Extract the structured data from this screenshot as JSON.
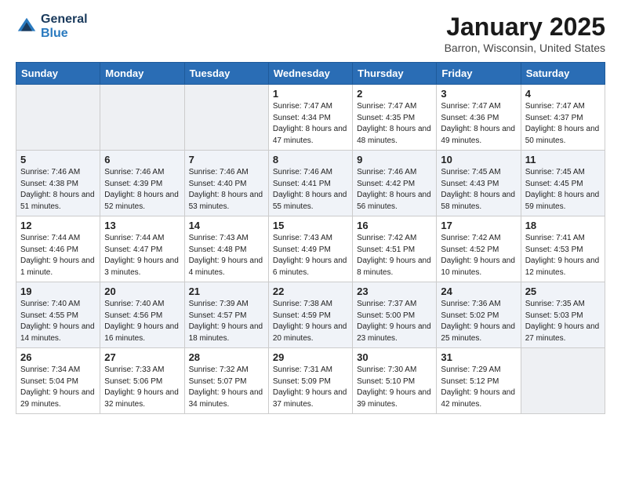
{
  "header": {
    "logo_line1": "General",
    "logo_line2": "Blue",
    "month": "January 2025",
    "location": "Barron, Wisconsin, United States"
  },
  "weekdays": [
    "Sunday",
    "Monday",
    "Tuesday",
    "Wednesday",
    "Thursday",
    "Friday",
    "Saturday"
  ],
  "weeks": [
    [
      {
        "day": "",
        "text": ""
      },
      {
        "day": "",
        "text": ""
      },
      {
        "day": "",
        "text": ""
      },
      {
        "day": "1",
        "text": "Sunrise: 7:47 AM\nSunset: 4:34 PM\nDaylight: 8 hours and 47 minutes."
      },
      {
        "day": "2",
        "text": "Sunrise: 7:47 AM\nSunset: 4:35 PM\nDaylight: 8 hours and 48 minutes."
      },
      {
        "day": "3",
        "text": "Sunrise: 7:47 AM\nSunset: 4:36 PM\nDaylight: 8 hours and 49 minutes."
      },
      {
        "day": "4",
        "text": "Sunrise: 7:47 AM\nSunset: 4:37 PM\nDaylight: 8 hours and 50 minutes."
      }
    ],
    [
      {
        "day": "5",
        "text": "Sunrise: 7:46 AM\nSunset: 4:38 PM\nDaylight: 8 hours and 51 minutes."
      },
      {
        "day": "6",
        "text": "Sunrise: 7:46 AM\nSunset: 4:39 PM\nDaylight: 8 hours and 52 minutes."
      },
      {
        "day": "7",
        "text": "Sunrise: 7:46 AM\nSunset: 4:40 PM\nDaylight: 8 hours and 53 minutes."
      },
      {
        "day": "8",
        "text": "Sunrise: 7:46 AM\nSunset: 4:41 PM\nDaylight: 8 hours and 55 minutes."
      },
      {
        "day": "9",
        "text": "Sunrise: 7:46 AM\nSunset: 4:42 PM\nDaylight: 8 hours and 56 minutes."
      },
      {
        "day": "10",
        "text": "Sunrise: 7:45 AM\nSunset: 4:43 PM\nDaylight: 8 hours and 58 minutes."
      },
      {
        "day": "11",
        "text": "Sunrise: 7:45 AM\nSunset: 4:45 PM\nDaylight: 8 hours and 59 minutes."
      }
    ],
    [
      {
        "day": "12",
        "text": "Sunrise: 7:44 AM\nSunset: 4:46 PM\nDaylight: 9 hours and 1 minute."
      },
      {
        "day": "13",
        "text": "Sunrise: 7:44 AM\nSunset: 4:47 PM\nDaylight: 9 hours and 3 minutes."
      },
      {
        "day": "14",
        "text": "Sunrise: 7:43 AM\nSunset: 4:48 PM\nDaylight: 9 hours and 4 minutes."
      },
      {
        "day": "15",
        "text": "Sunrise: 7:43 AM\nSunset: 4:49 PM\nDaylight: 9 hours and 6 minutes."
      },
      {
        "day": "16",
        "text": "Sunrise: 7:42 AM\nSunset: 4:51 PM\nDaylight: 9 hours and 8 minutes."
      },
      {
        "day": "17",
        "text": "Sunrise: 7:42 AM\nSunset: 4:52 PM\nDaylight: 9 hours and 10 minutes."
      },
      {
        "day": "18",
        "text": "Sunrise: 7:41 AM\nSunset: 4:53 PM\nDaylight: 9 hours and 12 minutes."
      }
    ],
    [
      {
        "day": "19",
        "text": "Sunrise: 7:40 AM\nSunset: 4:55 PM\nDaylight: 9 hours and 14 minutes."
      },
      {
        "day": "20",
        "text": "Sunrise: 7:40 AM\nSunset: 4:56 PM\nDaylight: 9 hours and 16 minutes."
      },
      {
        "day": "21",
        "text": "Sunrise: 7:39 AM\nSunset: 4:57 PM\nDaylight: 9 hours and 18 minutes."
      },
      {
        "day": "22",
        "text": "Sunrise: 7:38 AM\nSunset: 4:59 PM\nDaylight: 9 hours and 20 minutes."
      },
      {
        "day": "23",
        "text": "Sunrise: 7:37 AM\nSunset: 5:00 PM\nDaylight: 9 hours and 23 minutes."
      },
      {
        "day": "24",
        "text": "Sunrise: 7:36 AM\nSunset: 5:02 PM\nDaylight: 9 hours and 25 minutes."
      },
      {
        "day": "25",
        "text": "Sunrise: 7:35 AM\nSunset: 5:03 PM\nDaylight: 9 hours and 27 minutes."
      }
    ],
    [
      {
        "day": "26",
        "text": "Sunrise: 7:34 AM\nSunset: 5:04 PM\nDaylight: 9 hours and 29 minutes."
      },
      {
        "day": "27",
        "text": "Sunrise: 7:33 AM\nSunset: 5:06 PM\nDaylight: 9 hours and 32 minutes."
      },
      {
        "day": "28",
        "text": "Sunrise: 7:32 AM\nSunset: 5:07 PM\nDaylight: 9 hours and 34 minutes."
      },
      {
        "day": "29",
        "text": "Sunrise: 7:31 AM\nSunset: 5:09 PM\nDaylight: 9 hours and 37 minutes."
      },
      {
        "day": "30",
        "text": "Sunrise: 7:30 AM\nSunset: 5:10 PM\nDaylight: 9 hours and 39 minutes."
      },
      {
        "day": "31",
        "text": "Sunrise: 7:29 AM\nSunset: 5:12 PM\nDaylight: 9 hours and 42 minutes."
      },
      {
        "day": "",
        "text": ""
      }
    ]
  ]
}
